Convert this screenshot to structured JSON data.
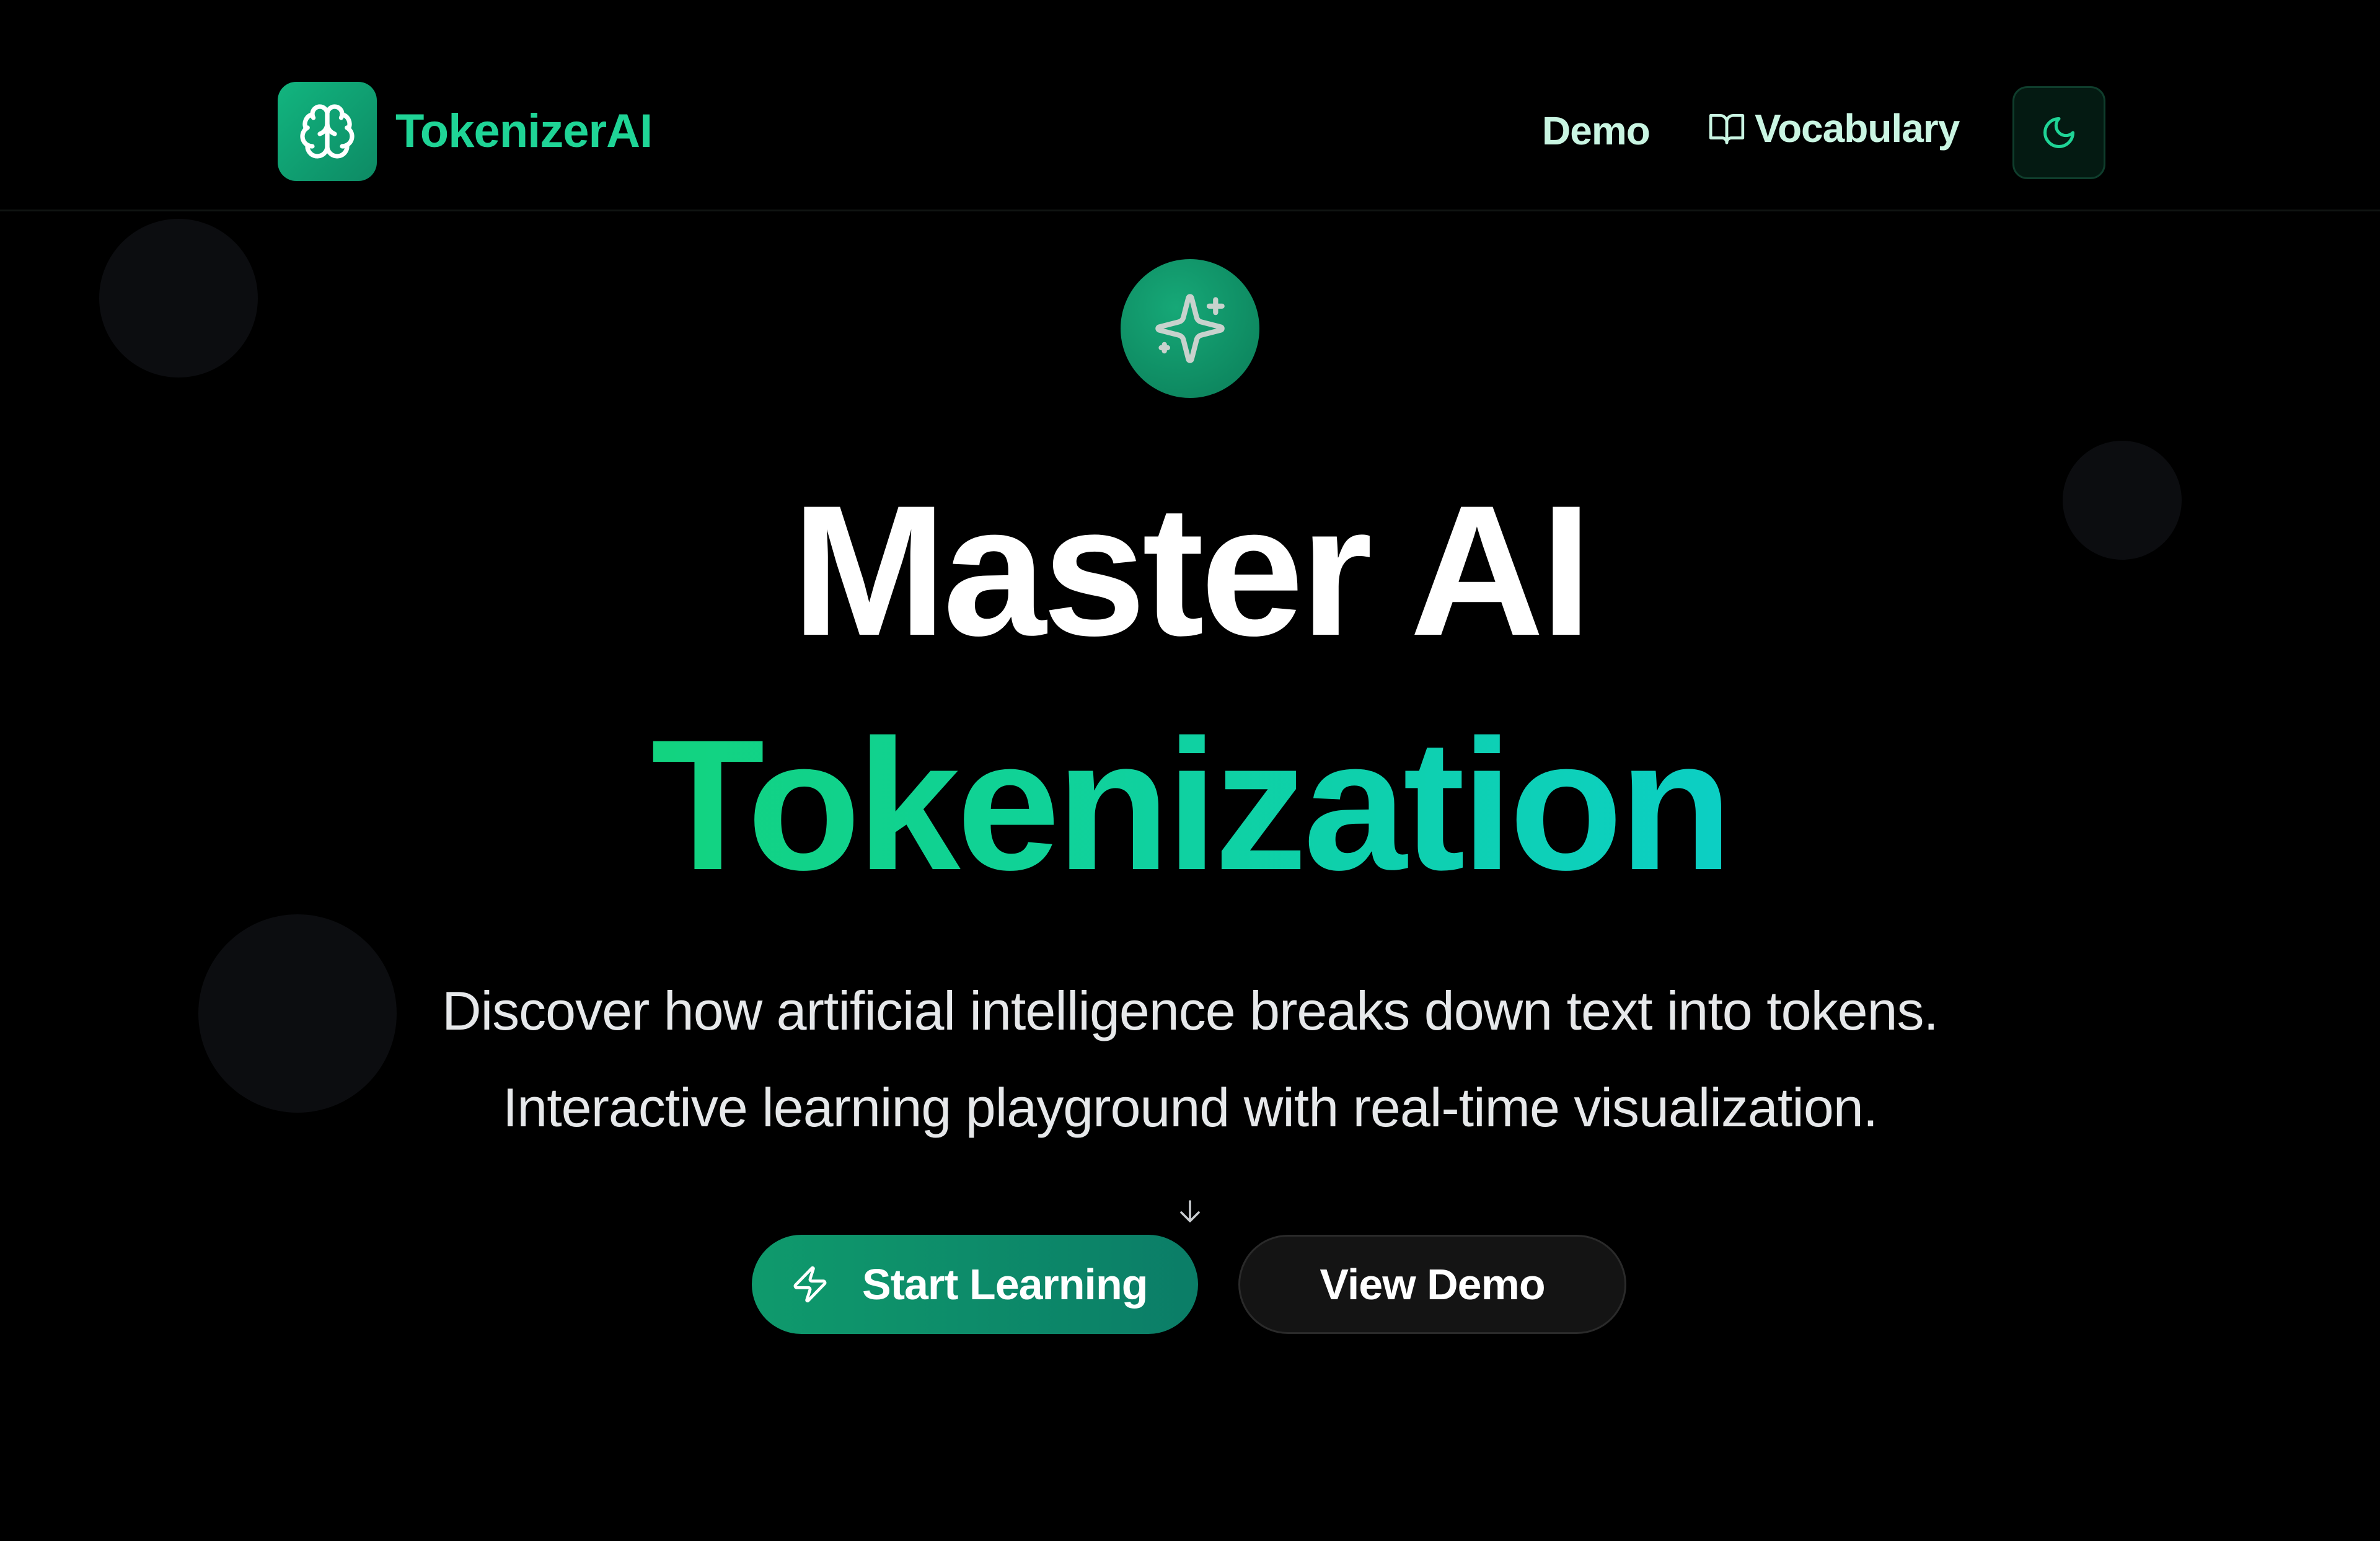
{
  "header": {
    "brand": "TokenizerAI",
    "nav": {
      "demo_label": "Demo",
      "vocabulary_label": "Vocabulary"
    },
    "logo_icon": "brain-icon",
    "vocabulary_icon": "book-open-icon",
    "theme_toggle_icon": "moon-icon"
  },
  "hero": {
    "badge_icon": "sparkles-icon",
    "title_line1": "Master AI",
    "title_line2": "Tokenization",
    "subtitle_line1": "Discover how artificial intelligence breaks down text into tokens.",
    "subtitle_line2": "Interactive learning playground with real-time visualization.",
    "scroll_icon": "arrow-down-icon",
    "primary_button": {
      "label": "Start Learning",
      "icon": "zap-icon"
    },
    "secondary_button": {
      "label": "View Demo"
    }
  },
  "colors": {
    "background": "#000000",
    "accent_green": "#12b57f",
    "brand_text": "#1fd496",
    "gradient_start": "#12d37f",
    "gradient_end": "#0ccfc4"
  }
}
